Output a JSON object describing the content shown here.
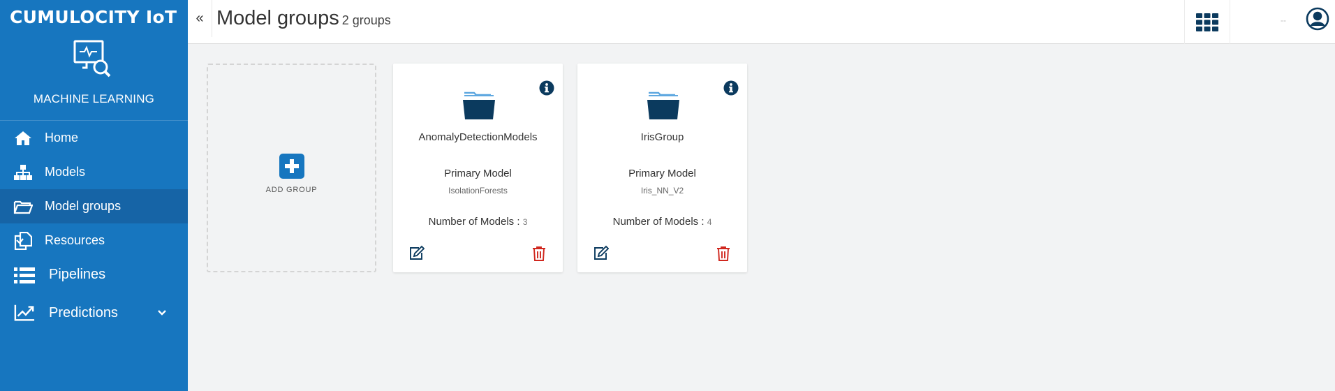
{
  "brand": "CUMULOCITY IoT",
  "app_name": "MACHINE LEARNING",
  "nav": [
    {
      "label": "Home",
      "icon": "home-icon"
    },
    {
      "label": "Models",
      "icon": "sitemap-icon"
    },
    {
      "label": "Model groups",
      "icon": "folder-open-icon",
      "active": true
    },
    {
      "label": "Resources",
      "icon": "files-icon"
    },
    {
      "label": "Pipelines",
      "icon": "list-icon"
    },
    {
      "label": "Predictions",
      "icon": "chart-line-icon",
      "expandable": true
    }
  ],
  "header": {
    "collapse_glyph": "«",
    "title": "Model groups",
    "count": "2 groups",
    "tenant": "--"
  },
  "add_group": {
    "label": "ADD GROUP"
  },
  "groups": [
    {
      "name": "AnomalyDetectionModels",
      "primary_label": "Primary Model",
      "primary_value": "IsolationForests",
      "num_label": "Number of Models :",
      "num_value": "3"
    },
    {
      "name": "IrisGroup",
      "primary_label": "Primary Model",
      "primary_value": "Iris_NN_V2",
      "num_label": "Number of Models :",
      "num_value": "4"
    }
  ],
  "colors": {
    "sidebar": "#1776bf",
    "sidebar_active": "#1664a6",
    "folder": "#0b3a5e",
    "folder_tab": "#5fa8e0",
    "delete": "#d0271e"
  }
}
